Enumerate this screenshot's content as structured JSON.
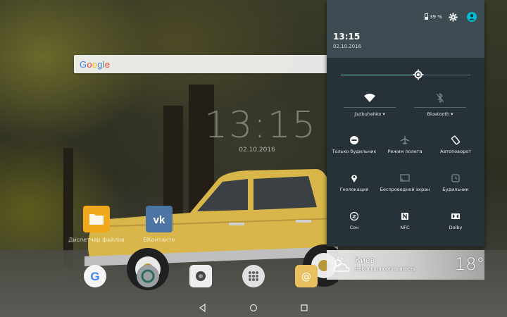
{
  "home": {
    "search": {
      "logo": "Google"
    },
    "clock": {
      "time": "13:15",
      "date": "02.10.2016"
    },
    "apps": [
      {
        "label": "Диспетчер файлов",
        "icon": "folder-icon"
      },
      {
        "label": "ВКонтакте",
        "icon": "vk-icon"
      }
    ],
    "dock": [
      "google-icon",
      "camera-lens-icon",
      "camera-icon",
      "app-drawer-icon",
      "email-icon"
    ]
  },
  "quick_settings": {
    "status": {
      "battery": "39 %"
    },
    "time": "13:15",
    "date": "02.10.2016",
    "brightness": 0.6,
    "wifi": {
      "label": "jiutbuhehko"
    },
    "bluetooth": {
      "label": "Bluetooth"
    },
    "tiles": [
      {
        "label": "Только будильник",
        "icon": "minus-circle-icon"
      },
      {
        "label": "Режим полета",
        "icon": "airplane-icon"
      },
      {
        "label": "Автоповорот",
        "icon": "rotate-icon"
      },
      {
        "label": "Геолокация",
        "icon": "location-icon"
      },
      {
        "label": "Беспроводной экран",
        "icon": "cast-icon"
      },
      {
        "label": "Будильник",
        "icon": "alarm-icon"
      },
      {
        "label": "Сон",
        "icon": "sleep-icon"
      },
      {
        "label": "NFC",
        "icon": "nfc-icon"
      },
      {
        "label": "Dolby",
        "icon": "dolby-icon"
      }
    ]
  },
  "weather": {
    "city": "Киев",
    "condition": "Небольшая облачность",
    "temp": "18°"
  },
  "colors": {
    "panel": "#263238",
    "header": "#3d4b52",
    "accent": "#80cbc4",
    "account": "#00bcd4"
  }
}
